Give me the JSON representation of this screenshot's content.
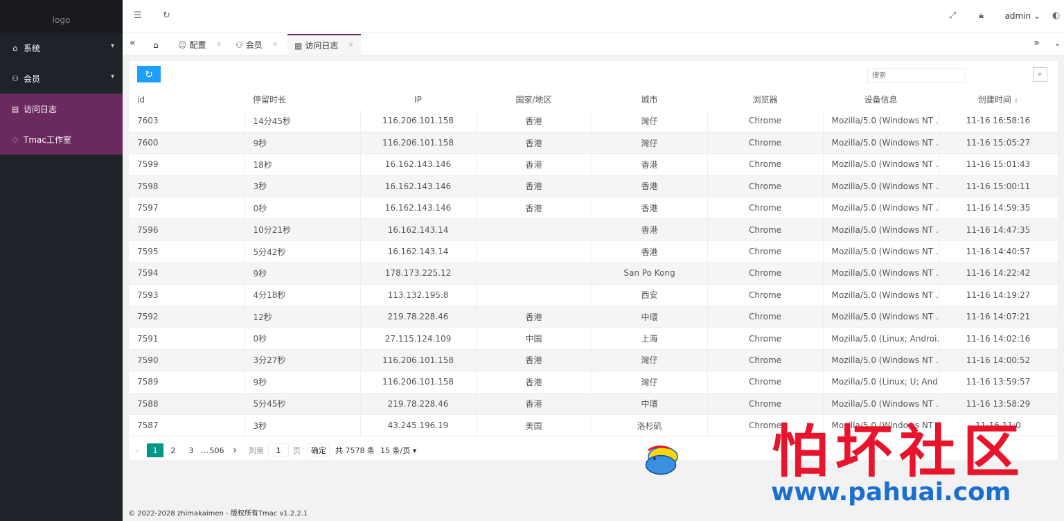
{
  "logo_alt": "logo",
  "sidebar": {
    "items": [
      {
        "label": "系统"
      },
      {
        "label": "会员"
      },
      {
        "label": "访问日志"
      },
      {
        "label": "Tmac工作室"
      }
    ]
  },
  "header": {
    "user": "admin"
  },
  "tabs": [
    {
      "label": "配置"
    },
    {
      "label": "会员"
    },
    {
      "label": "访问日志"
    }
  ],
  "search": {
    "placeholder": "搜索"
  },
  "table": {
    "columns": [
      "id",
      "停留时长",
      "IP",
      "国家/地区",
      "城市",
      "浏览器",
      "设备信息",
      "创建时间"
    ],
    "rows": [
      [
        "7603",
        "14分45秒",
        "116.206.101.158",
        "香港",
        "灣仔",
        "Chrome",
        "Mozilla/5.0 (Windows NT ...",
        "11-16 16:58:16"
      ],
      [
        "7600",
        "9秒",
        "116.206.101.158",
        "香港",
        "灣仔",
        "Chrome",
        "Mozilla/5.0 (Windows NT ...",
        "11-16 15:05:27"
      ],
      [
        "7599",
        "18秒",
        "16.162.143.146",
        "香港",
        "香港",
        "Chrome",
        "Mozilla/5.0 (Windows NT ...",
        "11-16 15:01:43"
      ],
      [
        "7598",
        "3秒",
        "16.162.143.146",
        "香港",
        "香港",
        "Chrome",
        "Mozilla/5.0 (Windows NT ...",
        "11-16 15:00:11"
      ],
      [
        "7597",
        "0秒",
        "16.162.143.146",
        "香港",
        "香港",
        "Chrome",
        "Mozilla/5.0 (Windows NT ...",
        "11-16 14:59:35"
      ],
      [
        "7596",
        "10分21秒",
        "16.162.143.14",
        "",
        "香港",
        "Chrome",
        "Mozilla/5.0 (Windows NT ...",
        "11-16 14:47:35"
      ],
      [
        "7595",
        "5分42秒",
        "16.162.143.14",
        "",
        "香港",
        "Chrome",
        "Mozilla/5.0 (Windows NT ...",
        "11-16 14:40:57"
      ],
      [
        "7594",
        "9秒",
        "178.173.225.12",
        "",
        "San Po Kong",
        "Chrome",
        "Mozilla/5.0 (Windows NT ...",
        "11-16 14:22:42"
      ],
      [
        "7593",
        "4分18秒",
        "113.132.195.8",
        "",
        "西安",
        "Chrome",
        "Mozilla/5.0 (Windows NT ...",
        "11-16 14:19:27"
      ],
      [
        "7592",
        "12秒",
        "219.78.228.46",
        "香港",
        "中環",
        "Chrome",
        "Mozilla/5.0 (Windows NT ...",
        "11-16 14:07:21"
      ],
      [
        "7591",
        "0秒",
        "27.115.124.109",
        "中国",
        "上海",
        "Chrome",
        "Mozilla/5.0 (Linux; Androi...",
        "11-16 14:02:16"
      ],
      [
        "7590",
        "3分27秒",
        "116.206.101.158",
        "香港",
        "灣仔",
        "Chrome",
        "Mozilla/5.0 (Windows NT ...",
        "11-16 14:00:52"
      ],
      [
        "7589",
        "9秒",
        "116.206.101.158",
        "香港",
        "灣仔",
        "Chrome",
        "Mozilla/5.0 (Linux; U; And...",
        "11-16 13:59:57"
      ],
      [
        "7588",
        "5分45秒",
        "219.78.228.46",
        "香港",
        "中環",
        "Chrome",
        "Mozilla/5.0 (Windows NT ...",
        "11-16 13:58:29"
      ],
      [
        "7587",
        "3秒",
        "43.245.196.19",
        "美国",
        "洛杉矶",
        "Chrome",
        "Mozilla/5.0 (Windows NT ...",
        "11-16 11:0"
      ]
    ]
  },
  "pager": {
    "pages": [
      "1",
      "2",
      "3"
    ],
    "ellipsis": "…",
    "last": "506",
    "goto_label": "到第",
    "goto_value": "1",
    "page_unit": "页",
    "confirm": "确定",
    "total": "共 7578 条",
    "per_page": "15 条/页"
  },
  "footer": "© 2022-2028 zhimakaimen - 版权所有Tmac v1.2.2.1",
  "watermark": {
    "text": "怕坏社区",
    "url": "www.pahuai.com"
  },
  "colors": {
    "sidebar": "#20222a",
    "active": "#6b2a5e",
    "primary": "#1e9fff",
    "page_current": "#009688"
  }
}
